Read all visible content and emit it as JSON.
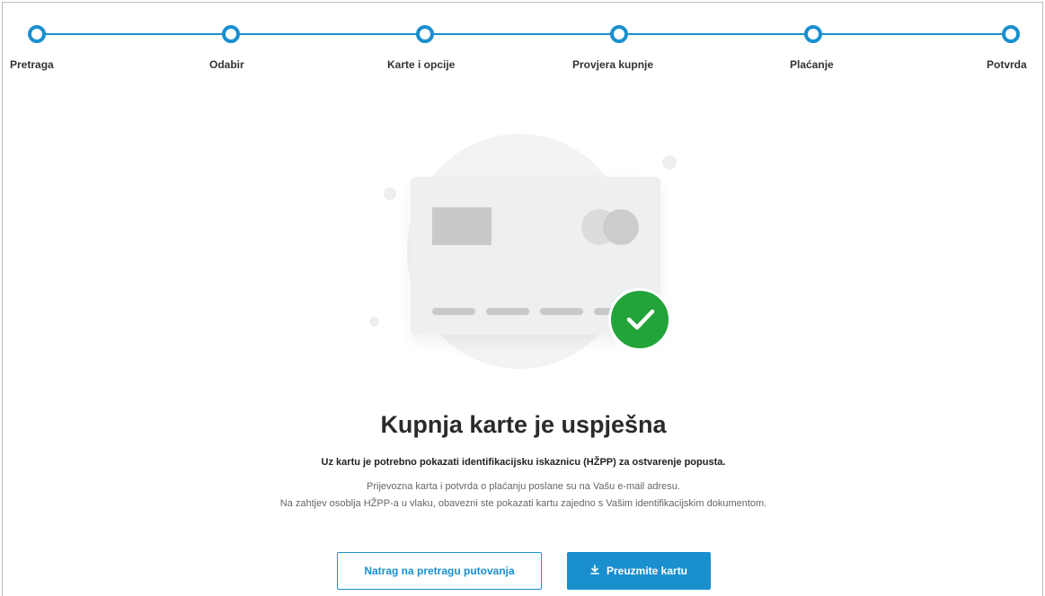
{
  "stepper": {
    "accent_color": "#1a8fce",
    "steps": [
      {
        "label": "Pretraga"
      },
      {
        "label": "Odabir"
      },
      {
        "label": "Karte i opcije"
      },
      {
        "label": "Provjera kupnje"
      },
      {
        "label": "Plaćanje"
      },
      {
        "label": "Potvrda"
      }
    ]
  },
  "illustration": {
    "icon": "credit-card-icon",
    "status_icon": "checkmark-icon",
    "status_color": "#23a43a"
  },
  "result": {
    "title": "Kupnja karte je uspješna",
    "subtitle": "Uz kartu je potrebno pokazati identifikacijsku iskaznicu (HŽPP) za ostvarenje popusta.",
    "info_line_1": "Prijevozna karta i potvrda o plaćanju poslane su na Vašu e-mail adresu.",
    "info_line_2": "Na zahtjev osoblja HŽPP-a u vlaku, obavezni ste pokazati kartu zajedno s Vašim identifikacijskim dokumentom."
  },
  "actions": {
    "back_label": "Natrag na pretragu putovanja",
    "download_label": "Preuzmite kartu",
    "download_icon": "download-icon"
  }
}
